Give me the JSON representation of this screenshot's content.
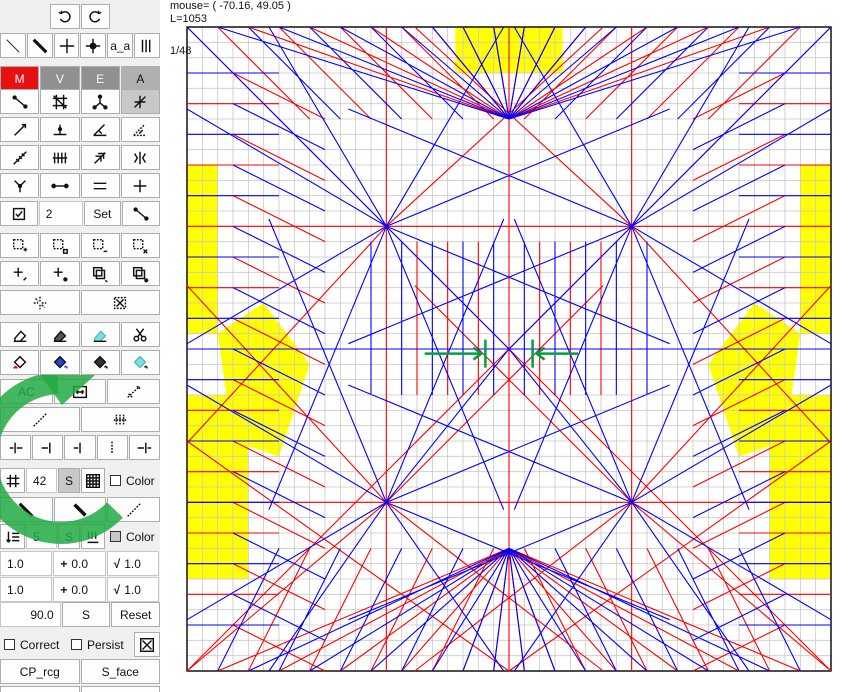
{
  "toolbar": {
    "undo_icon": "undo-arrow-icon",
    "redo_icon": "redo-arrow-icon",
    "line_text": "a_a",
    "mode": {
      "m": "M",
      "v": "V",
      "e": "E",
      "a": "A"
    },
    "polygon_count": "2",
    "set_label": "Set",
    "ac_label": "AC",
    "grid_count": "42",
    "s_label": "S",
    "color_label": "Color",
    "interval_value": "5",
    "s_label2": "S",
    "color_label2": "Color",
    "values": {
      "a": "1.0",
      "b": "0.0",
      "c": "1.0",
      "d": "1.0",
      "e": "0.0",
      "f": "1.0"
    },
    "angle_value": "90.0",
    "s_label3": "S",
    "reset_label": "Reset",
    "correct_label": "Correct",
    "persist_label": "Persist",
    "cp_rcg_label": "CP_rcg",
    "s_face_label": "S_face"
  },
  "canvas": {
    "mouse_text": "mouse= ( -70.16, 49.05 )",
    "length_text": "L=1053",
    "page_text": "1/48"
  },
  "colors": {
    "mountain": "#ff0000",
    "valley": "#0000ff",
    "grid": "#c8c8c8",
    "highlight": "#ffff00",
    "arrow": "#00a040",
    "overlay": "#22aa44"
  }
}
